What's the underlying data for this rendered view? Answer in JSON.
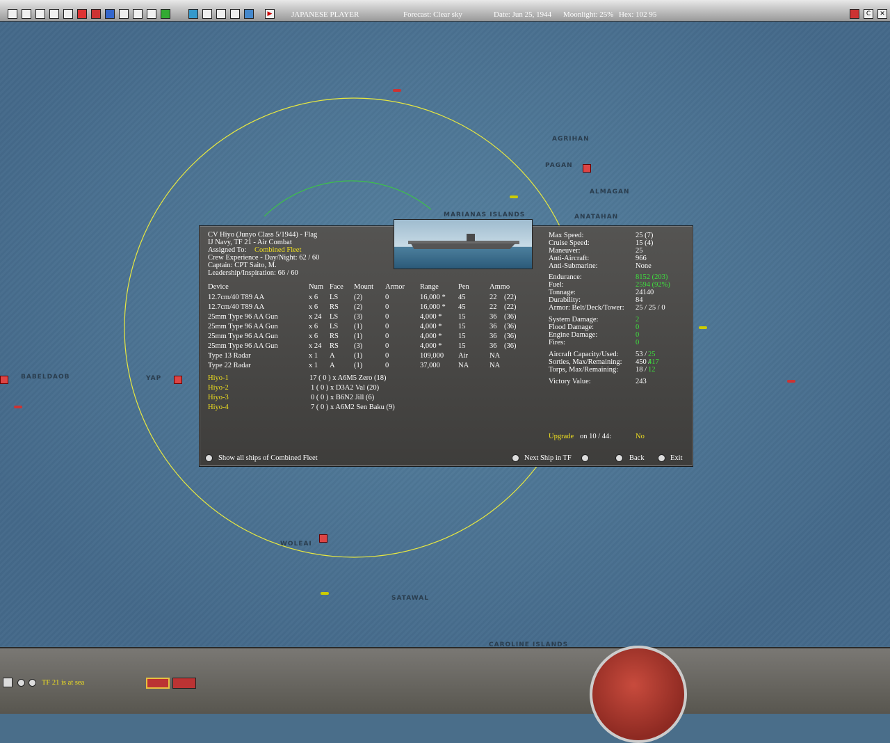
{
  "topbar": {
    "player": "JAPANESE PLAYER",
    "forecast": "Forecast: Clear sky",
    "date": "Date: Jun 25, 1944",
    "moonlight": "Moonlight: 25%",
    "hex": "Hex: 102 95",
    "right_buttons": [
      "C"
    ]
  },
  "map": {
    "islands": [
      "AGRIHAN",
      "PAGAN",
      "ALMAGAN",
      "ANATAHAN",
      "MARIANAS ISLANDS",
      "BABELDAOB",
      "YAP",
      "WOLEAI",
      "SATAWAL",
      "CAROLINE ISLANDS"
    ]
  },
  "ship": {
    "header": [
      "CV Hiyo (Junyo Class 5/1944) - Flag",
      "IJ Navy, TF 21 - Air Combat"
    ],
    "assigned_label": "Assigned To:",
    "assigned_value": "Combined Fleet",
    "crew": "Crew Experience - Day/Night: 62 / 60",
    "captain": "Captain: CPT Saito, M.",
    "leadership": "Leadership/Inspiration: 66 / 60",
    "device_headers": [
      "Device",
      "Num",
      "Face",
      "Mount",
      "Armor",
      "Range",
      "Pen",
      "Ammo"
    ],
    "devices": [
      [
        "12.7cm/40 T89 AA",
        "x 6",
        "LS",
        "(2)",
        "0",
        "16,000 *",
        "45",
        "22",
        "(22)"
      ],
      [
        "12.7cm/40 T89 AA",
        "x 6",
        "RS",
        "(2)",
        "0",
        "16,000 *",
        "45",
        "22",
        "(22)"
      ],
      [
        "25mm Type 96 AA Gun",
        "x 24",
        "LS",
        "(3)",
        "0",
        "4,000 *",
        "15",
        "36",
        "(36)"
      ],
      [
        "25mm Type 96 AA Gun",
        "x 6",
        "LS",
        "(1)",
        "0",
        "4,000 *",
        "15",
        "36",
        "(36)"
      ],
      [
        "25mm Type 96 AA Gun",
        "x 6",
        "RS",
        "(1)",
        "0",
        "4,000 *",
        "15",
        "36",
        "(36)"
      ],
      [
        "25mm Type 96 AA Gun",
        "x 24",
        "RS",
        "(3)",
        "0",
        "4,000 *",
        "15",
        "36",
        "(36)"
      ],
      [
        "Type 13 Radar",
        "x 1",
        "A",
        "(1)",
        "0",
        "109,000",
        "Air",
        "NA",
        ""
      ],
      [
        "Type 22 Radar",
        "x 1",
        "A",
        "(1)",
        "0",
        "37,000",
        "NA",
        "NA",
        ""
      ]
    ],
    "air_groups": [
      {
        "name": "Hiyo-1",
        "desc": "17 ( 0 ) x A6M5 Zero (18)"
      },
      {
        "name": "Hiyo-2",
        "desc": "1 ( 0 ) x D3A2 Val (20)"
      },
      {
        "name": "Hiyo-3",
        "desc": "0 ( 0 ) x B6N2 Jill (6)"
      },
      {
        "name": "Hiyo-4",
        "desc": "7 ( 0 ) x A6M2 Sen Baku (9)"
      }
    ],
    "stats1": [
      {
        "label": "Max Speed:",
        "value": "25 (7)"
      },
      {
        "label": "Cruise Speed:",
        "value": "15 (4)"
      },
      {
        "label": "Maneuver:",
        "value": "25"
      },
      {
        "label": "Anti-Aircraft:",
        "value": "966"
      },
      {
        "label": "Anti-Submarine:",
        "value": "None"
      }
    ],
    "stats2": [
      {
        "label": "Endurance:",
        "value": "8152 (203)",
        "color": "green"
      },
      {
        "label": "Fuel:",
        "value": "2594 (92%)",
        "color": "green"
      },
      {
        "label": "Tonnage:",
        "value": "24140"
      },
      {
        "label": "Durability:",
        "value": "84"
      },
      {
        "label": "Armor: Belt/Deck/Tower:",
        "value": "25 / 25 / 0"
      }
    ],
    "stats3": [
      {
        "label": "System Damage:",
        "value": "2"
      },
      {
        "label": "Flood Damage:",
        "value": "0"
      },
      {
        "label": "Engine Damage:",
        "value": "0"
      },
      {
        "label": "Fires:",
        "value": "0"
      }
    ],
    "stats4": [
      {
        "label": "Aircraft Capacity/Used:",
        "a": "53 /",
        "b": "25"
      },
      {
        "label": "Sorties, Max/Remaining:",
        "a": "450 /",
        "b": "417"
      },
      {
        "label": "Torps, Max/Remaining:",
        "a": "18 /",
        "b": "12"
      }
    ],
    "victory_label": "Victory Value:",
    "victory_value": "243",
    "upgrade_label": "Upgrade",
    "upgrade_on": "on  10 / 44:",
    "upgrade_value": "No",
    "btn_show_all": "Show all ships of Combined Fleet",
    "btn_next": "Next Ship in TF",
    "btn_back": "Back",
    "btn_exit": "Exit"
  },
  "bottom": {
    "status": "TF 21 is at sea"
  }
}
